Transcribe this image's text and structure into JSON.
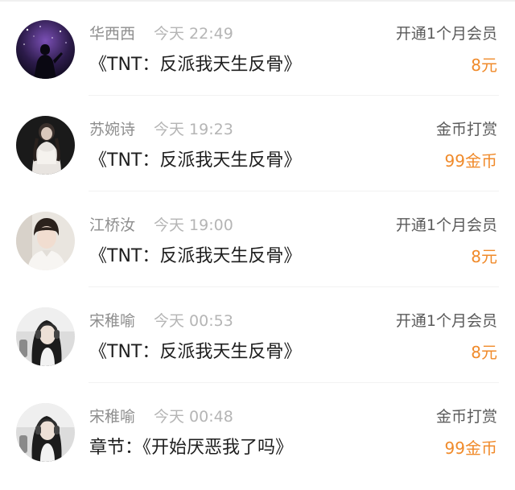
{
  "accent_color": "#f08a2a",
  "records": [
    {
      "avatar_icon": "avatar-starry-night-silhouette",
      "name": "华西西",
      "time": "今天 22:49",
      "title": "《TNT：反派我天生反骨》",
      "action": "开通1个月会员",
      "amount": "8元"
    },
    {
      "avatar_icon": "avatar-woman-white-dress",
      "name": "苏婉诗",
      "time": "今天 19:23",
      "title": "《TNT：反派我天生反骨》",
      "action": "金币打赏",
      "amount": "99金币"
    },
    {
      "avatar_icon": "avatar-young-man-portrait",
      "name": "江桥汝",
      "time": "今天 19:00",
      "title": "《TNT：反派我天生反骨》",
      "action": "开通1个月会员",
      "amount": "8元"
    },
    {
      "avatar_icon": "avatar-woman-headphones",
      "name": "宋稚喻",
      "time": "今天 00:53",
      "title": "《TNT：反派我天生反骨》",
      "action": "开通1个月会员",
      "amount": "8元"
    },
    {
      "avatar_icon": "avatar-woman-headphones",
      "name": "宋稚喻",
      "time": "今天 00:48",
      "title": "章节：《开始厌恶我了吗》",
      "action": "金币打赏",
      "amount": "99金币"
    }
  ]
}
